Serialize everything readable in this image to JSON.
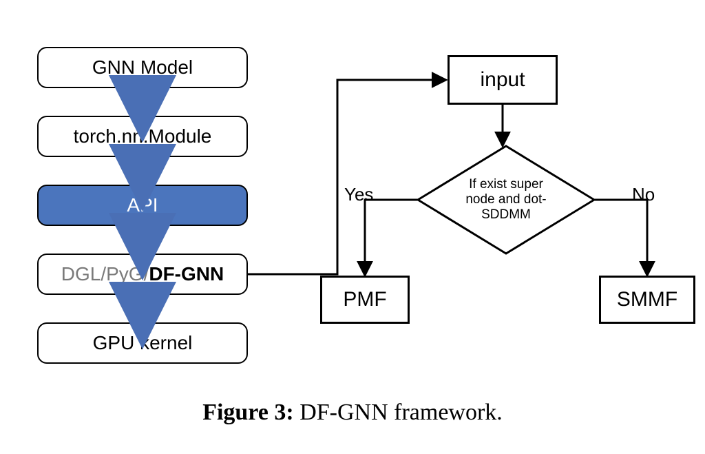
{
  "left_stack": {
    "box1": "GNN Model",
    "box2": "torch.nn.Module",
    "box3": "API",
    "box4_prefix": "DGL/PyG/",
    "box4_emph": "DF-GNN",
    "box5": "GPU kernel"
  },
  "flow": {
    "input": "input",
    "decision_line1": "If exist super",
    "decision_line2": "node and dot-",
    "decision_line3": "SDDMM",
    "yes": "Yes",
    "no": "No",
    "pmf": "PMF",
    "smmf": "SMMF"
  },
  "caption": {
    "label": "Figure 3:",
    "text": " DF-GNN framework."
  },
  "colors": {
    "api_bg": "#4b75bd",
    "arrow_blue": "#4a6fb5"
  }
}
